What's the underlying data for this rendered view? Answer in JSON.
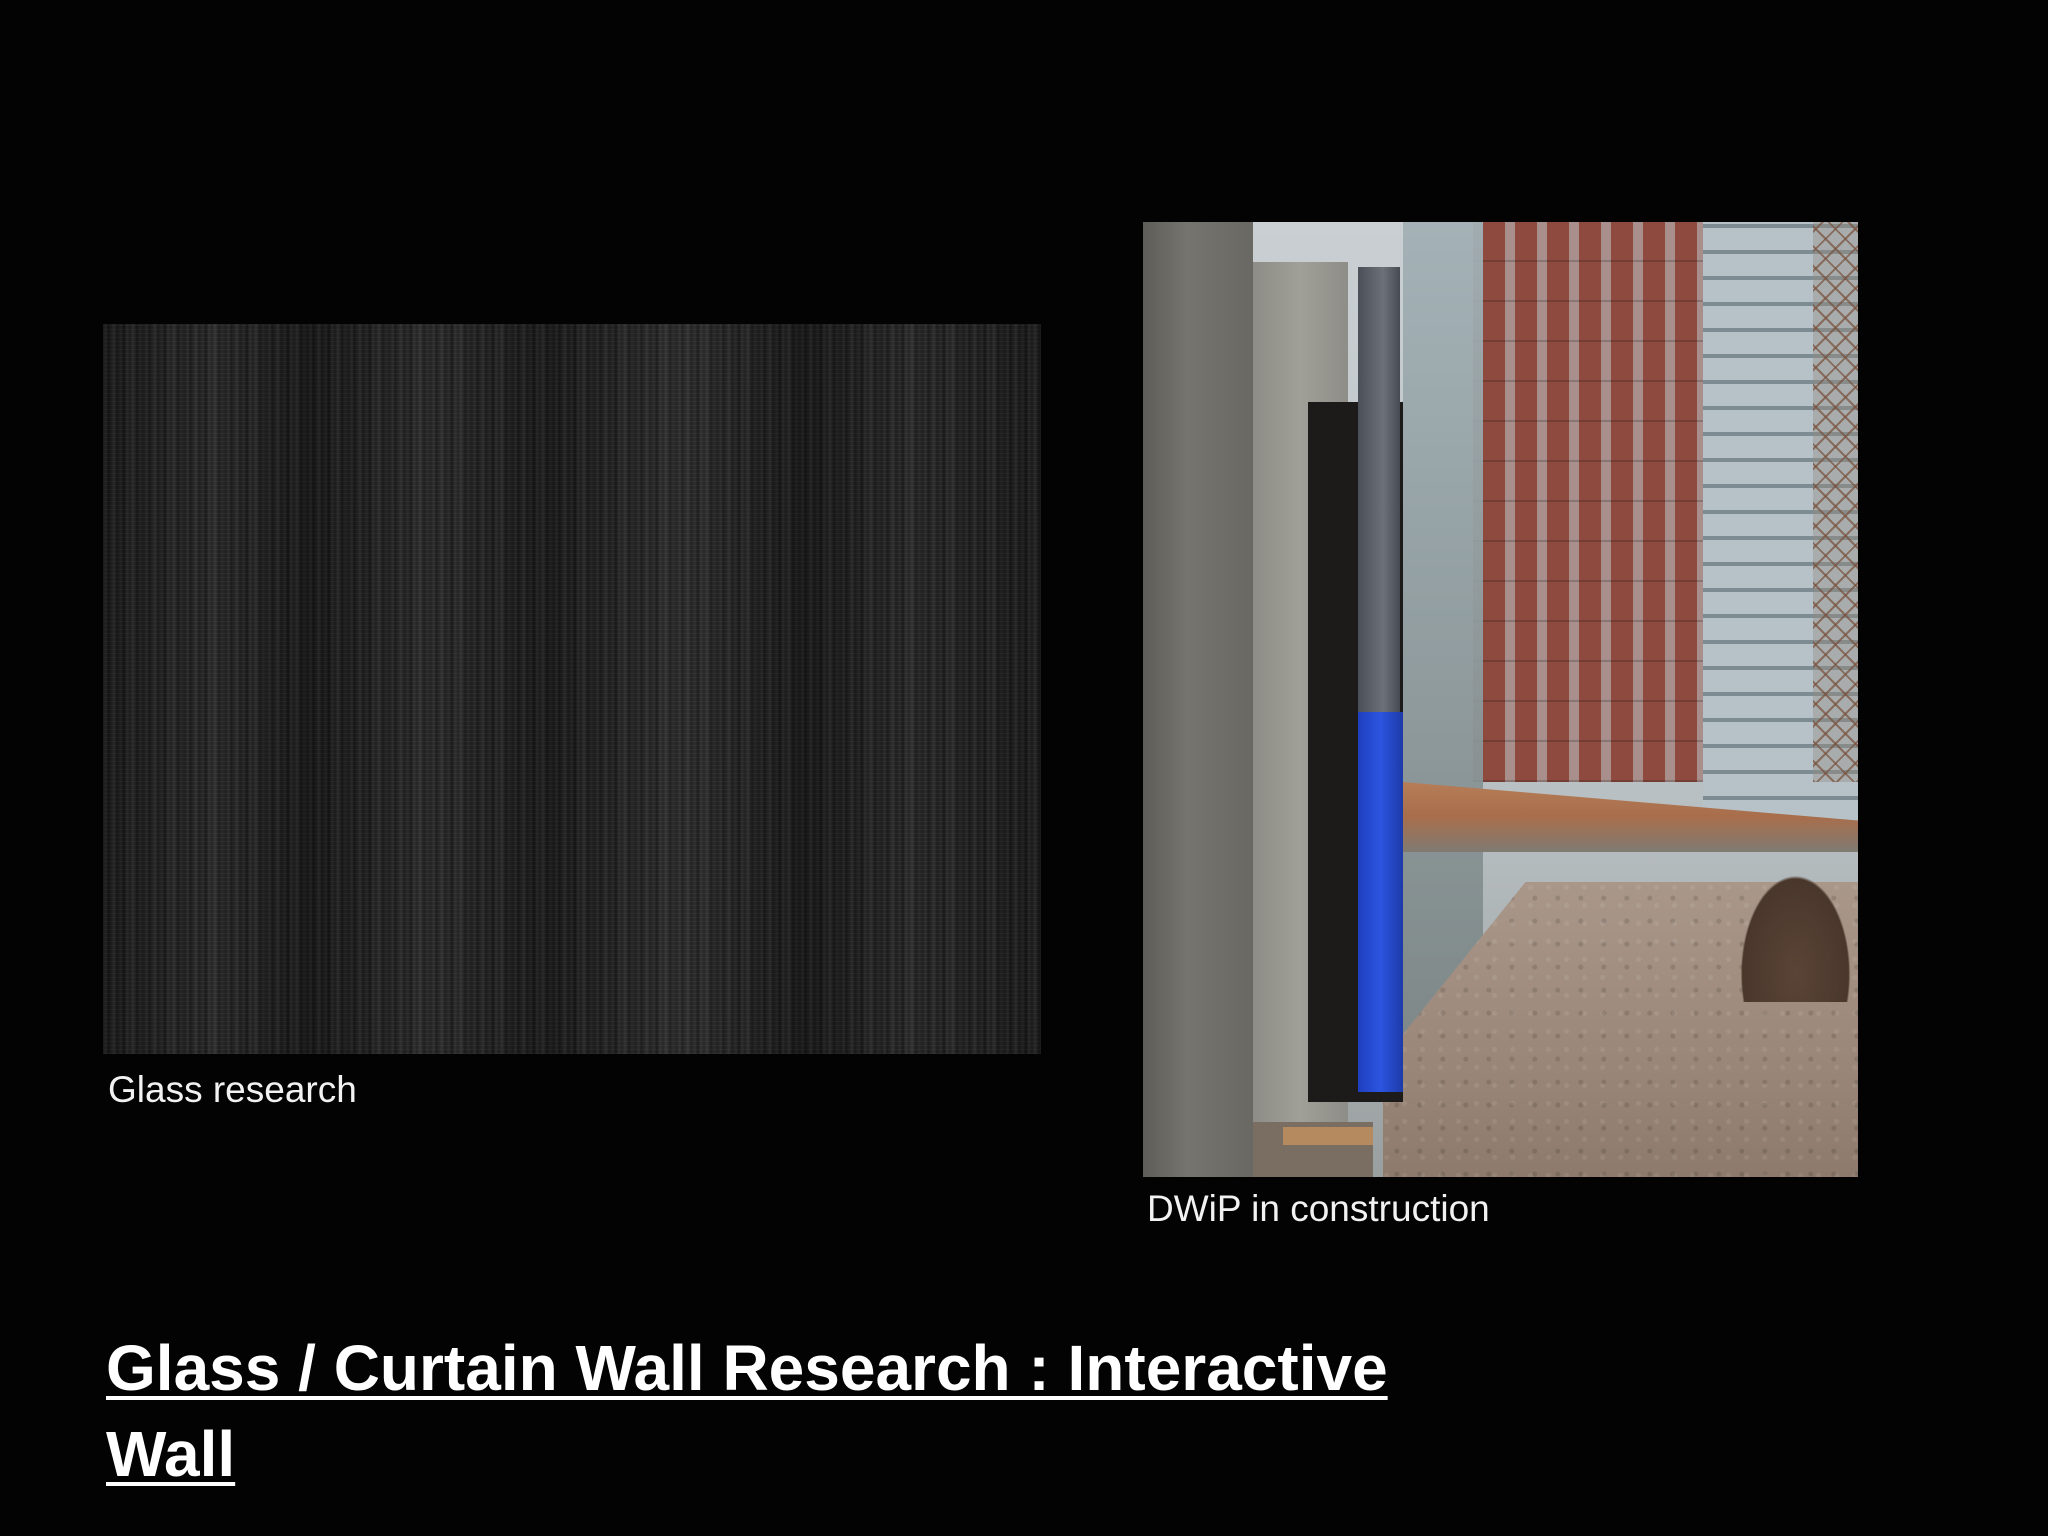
{
  "slide": {
    "left_image": {
      "caption": "Glass research",
      "icon": "noise-glass-texture"
    },
    "right_image": {
      "caption": "DWiP in construction",
      "icon": "construction-photo"
    },
    "title": "Glass / Curtain Wall Research : Interactive Wall"
  },
  "colors": {
    "background": "#030303",
    "text": "#ffffff",
    "blue_wrap": "#2b55e0",
    "brick": "#8e4a3e"
  }
}
